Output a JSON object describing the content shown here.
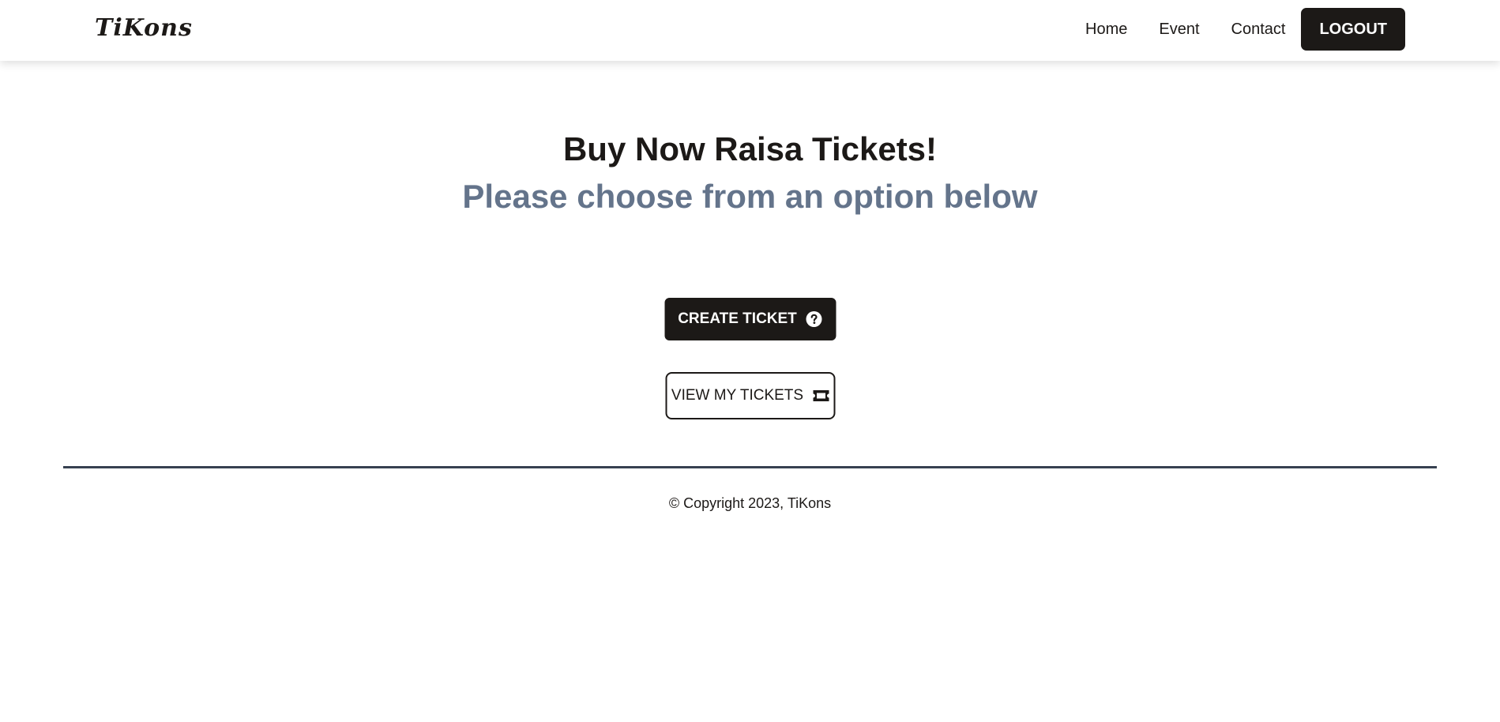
{
  "navbar": {
    "brand": "TiKons",
    "links": [
      {
        "label": "Home"
      },
      {
        "label": "Event"
      },
      {
        "label": "Contact"
      }
    ],
    "logout_label": "LOGOUT"
  },
  "hero": {
    "title": "Buy Now Raisa Tickets!",
    "subtitle": "Please choose from an option below"
  },
  "actions": {
    "create_label": "CREATE TICKET",
    "create_icon": "question-circle-icon",
    "view_label": "VIEW MY TICKETS",
    "view_icon": "ticket-icon"
  },
  "footer": {
    "copyright": "© Copyright 2023, TiKons"
  },
  "colors": {
    "primary": "#1c1917",
    "subtitle": "#64748b",
    "divider": "#374151",
    "background": "#ffffff"
  }
}
